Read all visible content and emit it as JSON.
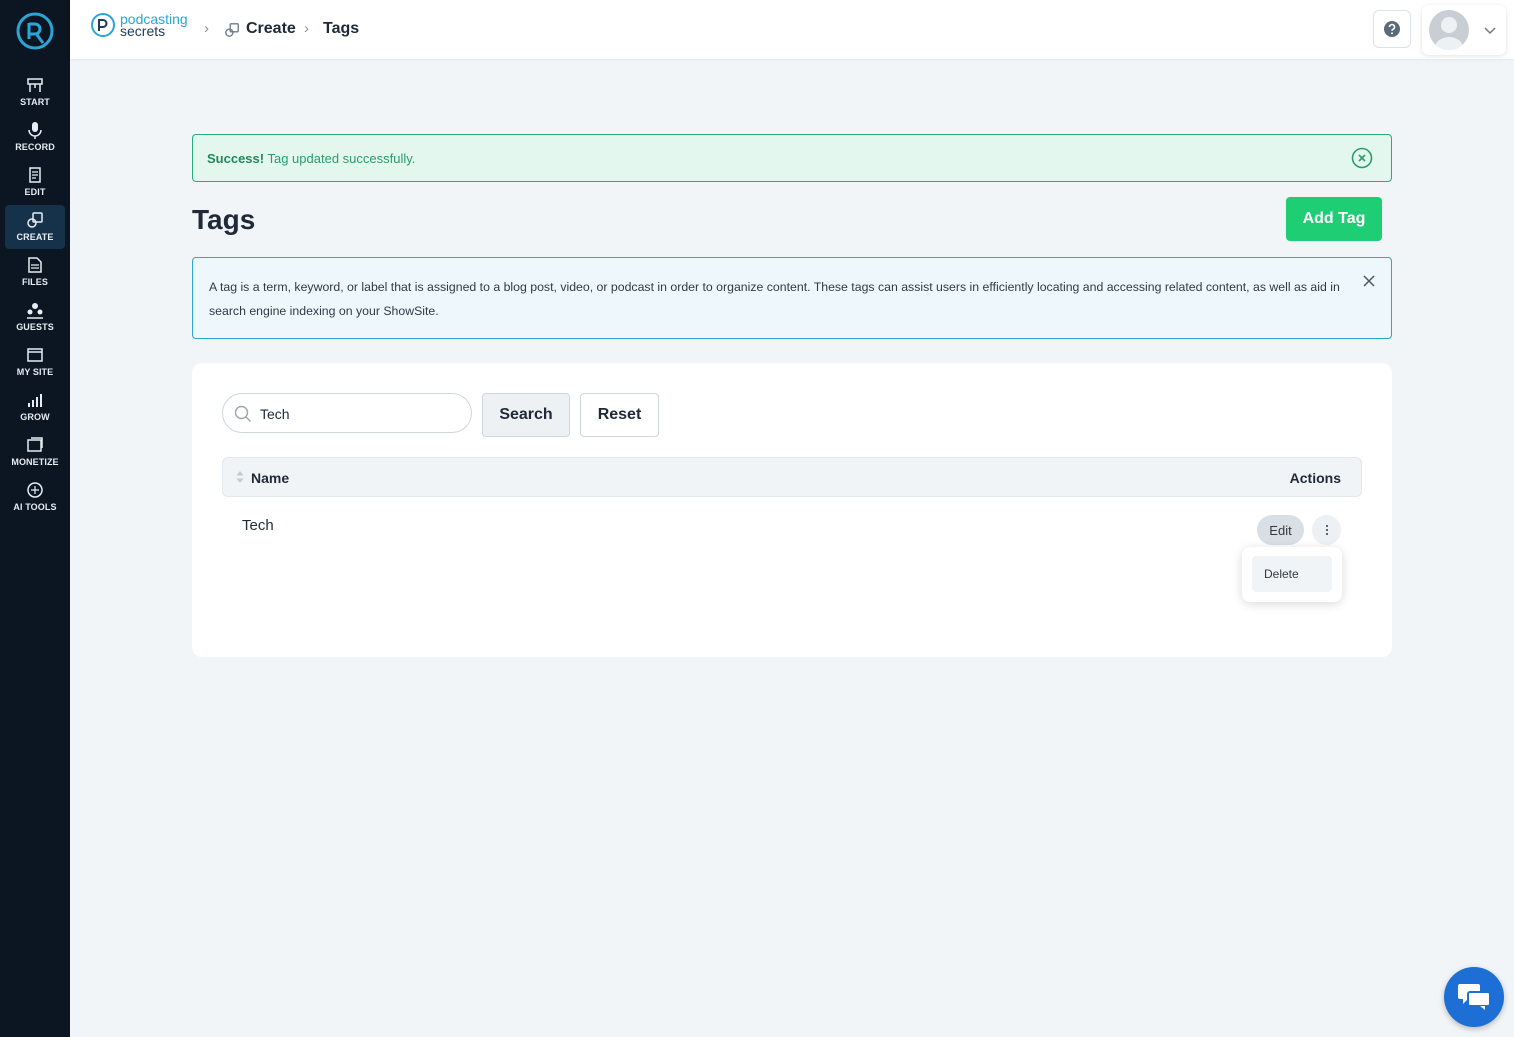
{
  "sidebar": {
    "logo_icon": "podcast-logo-icon",
    "items": [
      {
        "label": "START",
        "icon": "start-icon"
      },
      {
        "label": "RECORD",
        "icon": "microphone-icon"
      },
      {
        "label": "EDIT",
        "icon": "edit-icon"
      },
      {
        "label": "CREATE",
        "icon": "create-icon",
        "active": true
      },
      {
        "label": "FILES",
        "icon": "files-icon"
      },
      {
        "label": "GUESTS",
        "icon": "guests-icon"
      },
      {
        "label": "MY SITE",
        "icon": "site-icon"
      },
      {
        "label": "GROW",
        "icon": "chart-icon"
      },
      {
        "label": "MONETIZE",
        "icon": "monetize-icon"
      },
      {
        "label": "AI TOOLS",
        "icon": "ai-tools-icon"
      }
    ]
  },
  "header": {
    "brand_line1": "podcasting",
    "brand_line2": "secrets",
    "breadcrumb": [
      "Create",
      "Tags"
    ]
  },
  "alert": {
    "strong": "Success!",
    "message": "Tag updated successfully."
  },
  "page": {
    "title": "Tags",
    "add_button": "Add Tag"
  },
  "info": {
    "text": "A tag is a term, keyword, or label that is assigned to a blog post, video, or podcast in order to organize content. These tags can assist users in efficiently locating and accessing related content, as well as aid in search engine indexing on your ShowSite."
  },
  "search": {
    "value": "Tech",
    "search_label": "Search",
    "reset_label": "Reset"
  },
  "table": {
    "col_name": "Name",
    "col_actions": "Actions",
    "rows": [
      {
        "name": "Tech",
        "edit_label": "Edit"
      }
    ]
  },
  "dropdown": {
    "delete_label": "Delete"
  },
  "colors": {
    "sidebar": "#0b1622",
    "accent_green": "#1fce74",
    "info_blue": "#2aa5d6",
    "chat_blue": "#1d6fd6"
  }
}
